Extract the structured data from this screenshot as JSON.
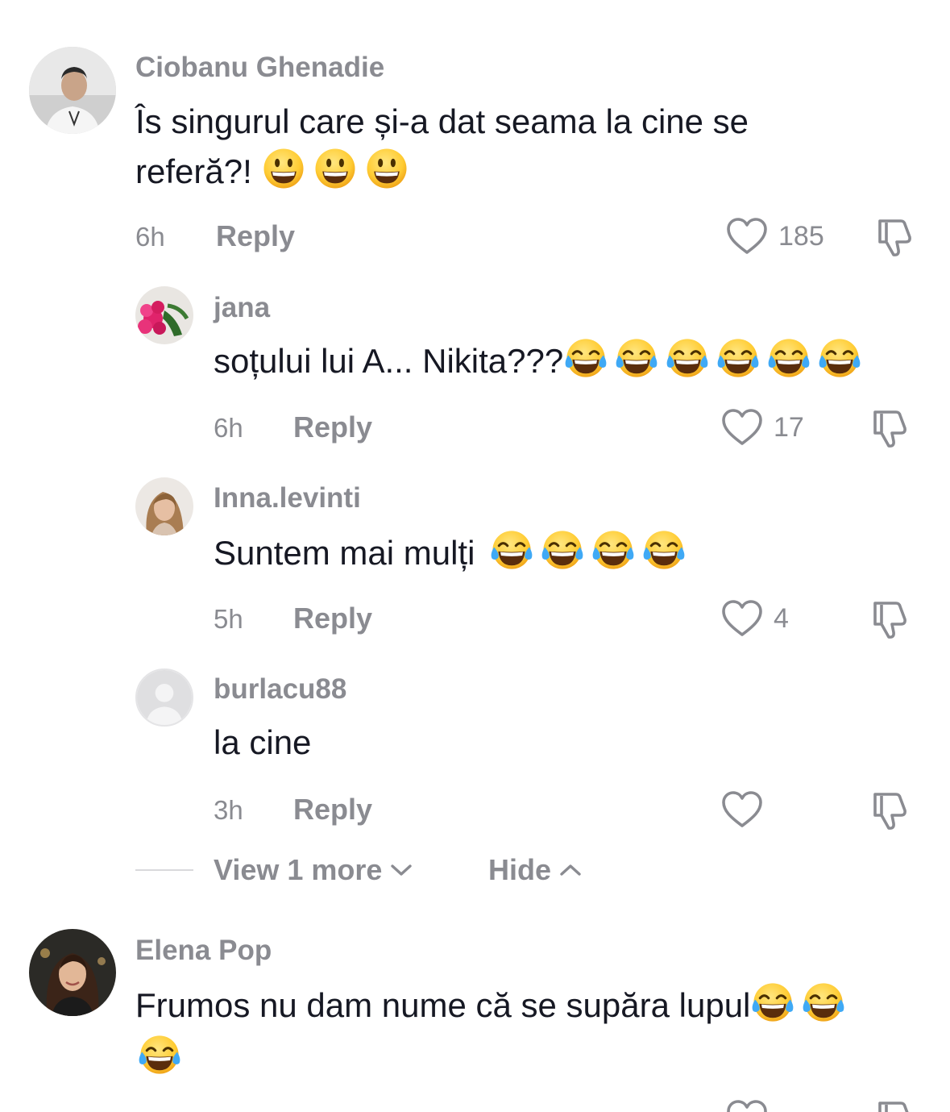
{
  "comments": [
    {
      "username": "Ciobanu Ghenadie",
      "text_line1": "Îs singurul care și-a dat seama la cine se",
      "text_line2": "referă?!",
      "emoji": "grinning-face",
      "emoji_count": 3,
      "time": "6h",
      "reply_label": "Reply",
      "likes": "185"
    },
    {
      "username": "jana",
      "text_line1": "soțului lui A... Nikita???",
      "emoji": "tears-of-joy",
      "emoji_count": 6,
      "time": "6h",
      "reply_label": "Reply",
      "likes": "17"
    },
    {
      "username": "Inna.levinti",
      "text_line1": "Suntem mai mulți",
      "emoji": "tears-of-joy",
      "emoji_count": 4,
      "time": "5h",
      "reply_label": "Reply",
      "likes": "4"
    },
    {
      "username": "burlacu88",
      "text_line1": "la cine",
      "time": "3h",
      "reply_label": "Reply",
      "likes": ""
    },
    {
      "username": "Elena Pop",
      "text_line1": "Frumos nu dam nume că se supăra lupul",
      "emoji": "tears-of-joy",
      "emoji_count": 3
    }
  ],
  "thread_controls": {
    "view_more_label": "View 1 more",
    "hide_label": "Hide"
  },
  "colors": {
    "text": "#161823",
    "muted": "#8a8b91",
    "emoji_yellow": "#ffcc33",
    "tear_blue": "#3fa9f5"
  }
}
